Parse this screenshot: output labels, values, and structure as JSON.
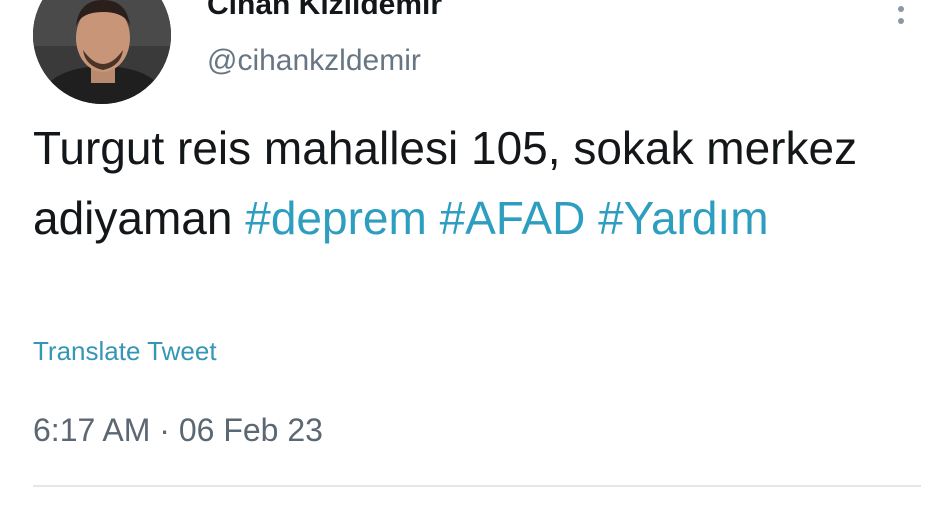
{
  "tweet": {
    "display_name": "Cihan Kızıldemir",
    "handle": "@cihankzldemir",
    "text_plain": "Turgut reis mahallesi 105, sokak merkez adiyaman ",
    "hashtags": [
      "#deprem",
      "#AFAD",
      "#Yardım"
    ],
    "translate_label": "Translate Tweet",
    "timestamp": "6:17 AM · 06 Feb 23"
  },
  "colors": {
    "hashtag": "#2d9ec0",
    "link": "#3596b5",
    "secondary_text": "#687684",
    "primary_text": "#14171a"
  },
  "icons": {
    "more": "more-vertical-icon"
  }
}
